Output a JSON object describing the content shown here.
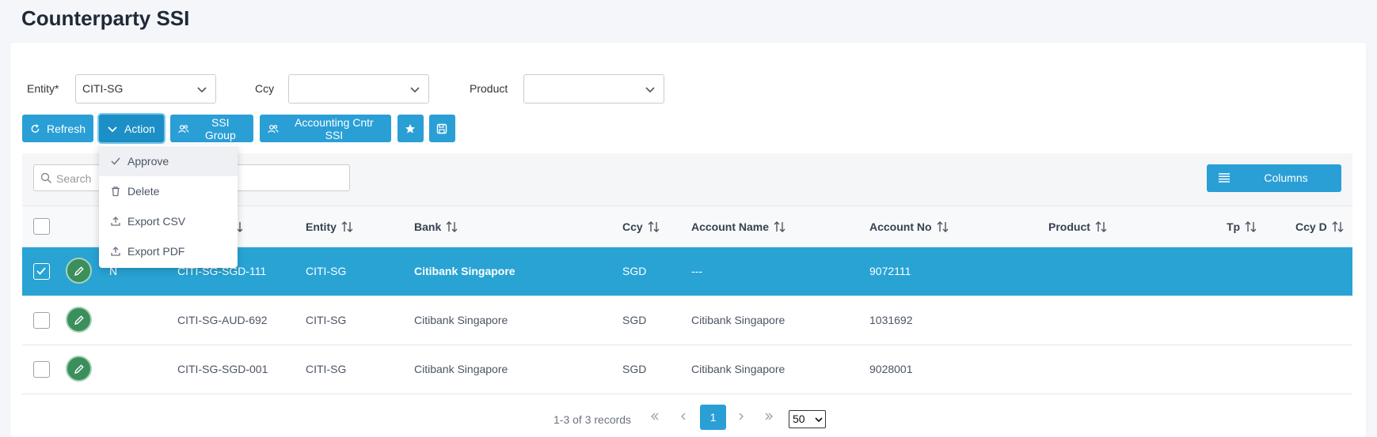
{
  "page": {
    "title": "Counterparty SSI"
  },
  "filters": {
    "entity_label": "Entity*",
    "entity_value": "CITI-SG",
    "ccy_label": "Ccy",
    "ccy_value": "",
    "product_label": "Product",
    "product_value": ""
  },
  "toolbar": {
    "refresh": "Refresh",
    "action": "Action",
    "ssi_group": "SSI Group",
    "accounting_cntr_ssi": "Accounting Cntr SSI"
  },
  "action_menu": {
    "items": [
      "Approve",
      "Delete",
      "Export CSV",
      "Export PDF"
    ]
  },
  "grid": {
    "search_placeholder": "Search",
    "columns_button": "Columns",
    "headers": [
      "Entity",
      "Bank",
      "Ccy",
      "Account Name",
      "Account No",
      "Product",
      "Tp",
      "Ccy D"
    ],
    "rows": [
      {
        "status": "N",
        "ssi_code": "CITI-SG-SGD-111",
        "entity": "CITI-SG",
        "bank": "Citibank Singapore",
        "ccy": "SGD",
        "account_name": "---",
        "account_no": "9072111",
        "selected": true
      },
      {
        "status": "",
        "ssi_code": "CITI-SG-AUD-692",
        "entity": "CITI-SG",
        "bank": "Citibank Singapore",
        "ccy": "SGD",
        "account_name": "Citibank Singapore",
        "account_no": "1031692",
        "selected": false
      },
      {
        "status": "",
        "ssi_code": "CITI-SG-SGD-001",
        "entity": "CITI-SG",
        "bank": "Citibank Singapore",
        "ccy": "SGD",
        "account_name": "Citibank Singapore",
        "account_no": "9028001",
        "selected": false
      }
    ]
  },
  "pagination": {
    "summary": "1-3 of 3 records",
    "current_page": "1",
    "page_size": "50"
  },
  "colors": {
    "accent": "#2a9fd6",
    "selected_row": "#28a3d4",
    "edit_button": "#3b8f5c"
  }
}
